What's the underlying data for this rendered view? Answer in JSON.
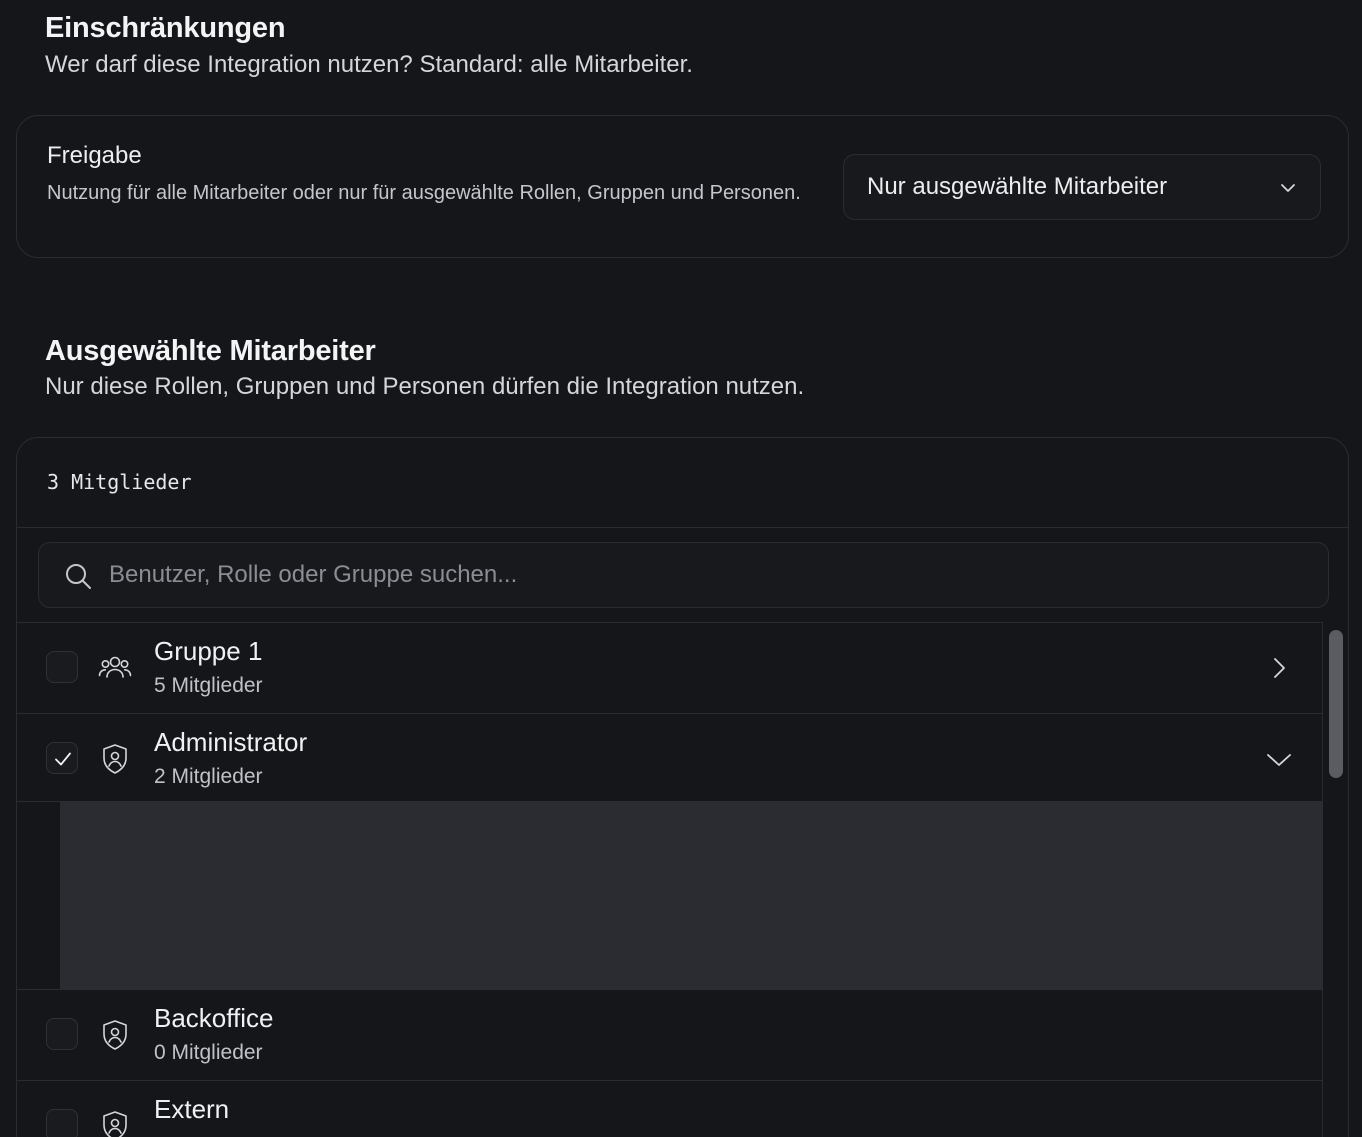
{
  "restrictions": {
    "title": "Einschränkungen",
    "subtitle": "Wer darf diese Integration nutzen? Standard: alle Mitarbeiter."
  },
  "freigabe": {
    "label": "Freigabe",
    "description": "Nutzung für alle Mitarbeiter oder nur für ausgewählte Rollen, Gruppen und Personen.",
    "selected_value": "Nur ausgewählte Mitarbeiter",
    "icon": "chevron-down-icon"
  },
  "selected_members": {
    "title": "Ausgewählte Mitarbeiter",
    "subtitle": "Nur diese Rollen, Gruppen und Personen dürfen die Integration nutzen.",
    "count_label": "3 Mitglieder",
    "search_placeholder": "Benutzer, Rolle oder Gruppe suchen...",
    "items": [
      {
        "name": "Gruppe 1",
        "count": "5 Mitglieder",
        "icon": "users-group-icon",
        "checked": false,
        "chevron": "chevron-right-icon"
      },
      {
        "name": "Administrator",
        "count": "2 Mitglieder",
        "icon": "shield-user-icon",
        "checked": true,
        "chevron": "chevron-down-icon"
      },
      {
        "name": "Backoffice",
        "count": "0 Mitglieder",
        "icon": "shield-user-icon",
        "checked": false
      },
      {
        "name": "Extern",
        "count": "",
        "icon": "shield-user-icon",
        "checked": false
      }
    ]
  },
  "colors": {
    "background": "#151619",
    "border": "#2A2C31",
    "expanded_panel": "#2B2C32",
    "text_primary": "#ECEDEF",
    "text_secondary": "#BFC2C8",
    "placeholder": "#8A8D94"
  }
}
